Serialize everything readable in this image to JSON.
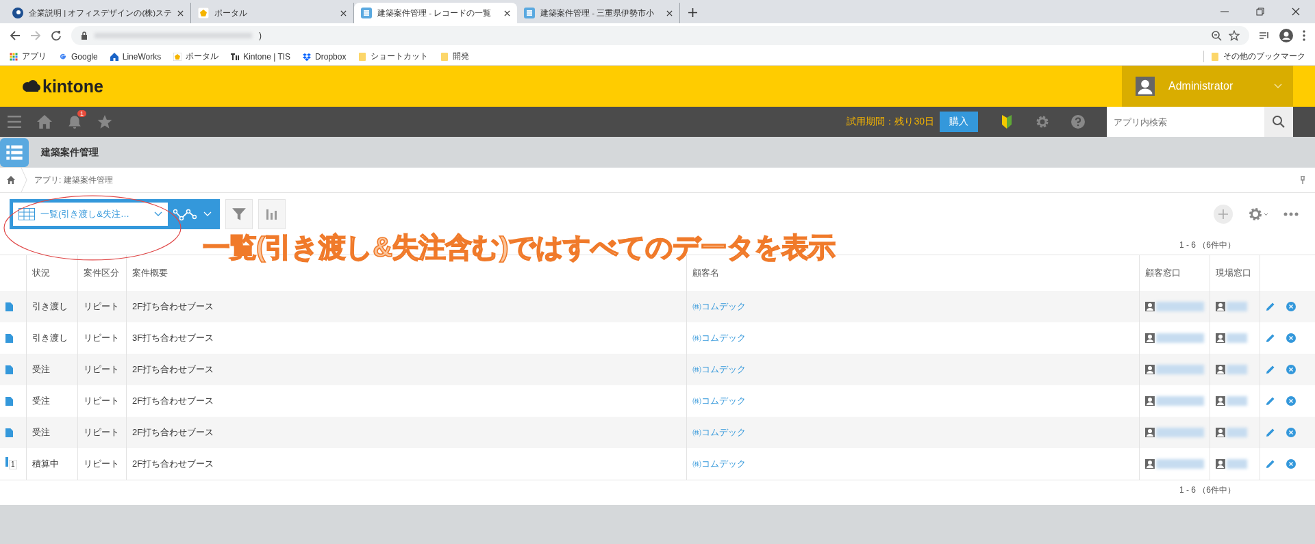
{
  "browser": {
    "tabs": [
      {
        "title": "企業説明 | オフィスデザインの(株)ステ",
        "selected": false
      },
      {
        "title": "ポータル",
        "selected": false
      },
      {
        "title": "建築案件管理 - レコードの一覧",
        "selected": true
      },
      {
        "title": "建築案件管理 - 三重県伊勢市小",
        "selected": false
      }
    ],
    "url_tail": ")",
    "bookmarks": [
      {
        "label": "アプリ"
      },
      {
        "label": "Google"
      },
      {
        "label": "LineWorks"
      },
      {
        "label": "ポータル"
      },
      {
        "label": "Kintone | TIS"
      },
      {
        "label": "Dropbox"
      },
      {
        "label": "ショートカット"
      },
      {
        "label": "開発"
      }
    ],
    "other_bookmarks": "その他のブックマーク"
  },
  "header": {
    "logo": "kintone",
    "user": "Administrator"
  },
  "nav": {
    "notification_count": "1",
    "trial": "試用期間：残り30日",
    "buy": "購入",
    "search": {
      "placeholder": "アプリ内検索"
    }
  },
  "app_title": "建築案件管理",
  "breadcrumb": "アプリ: 建築案件管理",
  "view_selector": "一覧(引き渡し&失注…",
  "annotation": "一覧(引き渡し&失注含む)ではすべてのデータを表示",
  "count_top": "1 - 6 （6件中）",
  "table": {
    "columns": [
      "状況",
      "案件区分",
      "案件概要",
      "顧客名",
      "顧客窓口",
      "現場窓口"
    ],
    "rows": [
      {
        "kind": "record",
        "status": "引き渡し",
        "category": "リピート",
        "summary": "2F打ち合わせブース",
        "customer": "㈱コムデック"
      },
      {
        "kind": "record",
        "status": "引き渡し",
        "category": "リピート",
        "summary": "3F打ち合わせブース",
        "customer": "㈱コムデック"
      },
      {
        "kind": "record",
        "status": "受注",
        "category": "リピート",
        "summary": "2F打ち合わせブース",
        "customer": "㈱コムデック"
      },
      {
        "kind": "record",
        "status": "受注",
        "category": "リピート",
        "summary": "2F打ち合わせブース",
        "customer": "㈱コムデック"
      },
      {
        "kind": "record",
        "status": "受注",
        "category": "リピート",
        "summary": "2F打ち合わせブース",
        "customer": "㈱コムデック"
      },
      {
        "kind": "pending",
        "badge": "1",
        "status": "積算中",
        "category": "リピート",
        "summary": "2F打ち合わせブース",
        "customer": "㈱コムデック"
      }
    ]
  },
  "count_bottom": "1 - 6 （6件中）"
}
